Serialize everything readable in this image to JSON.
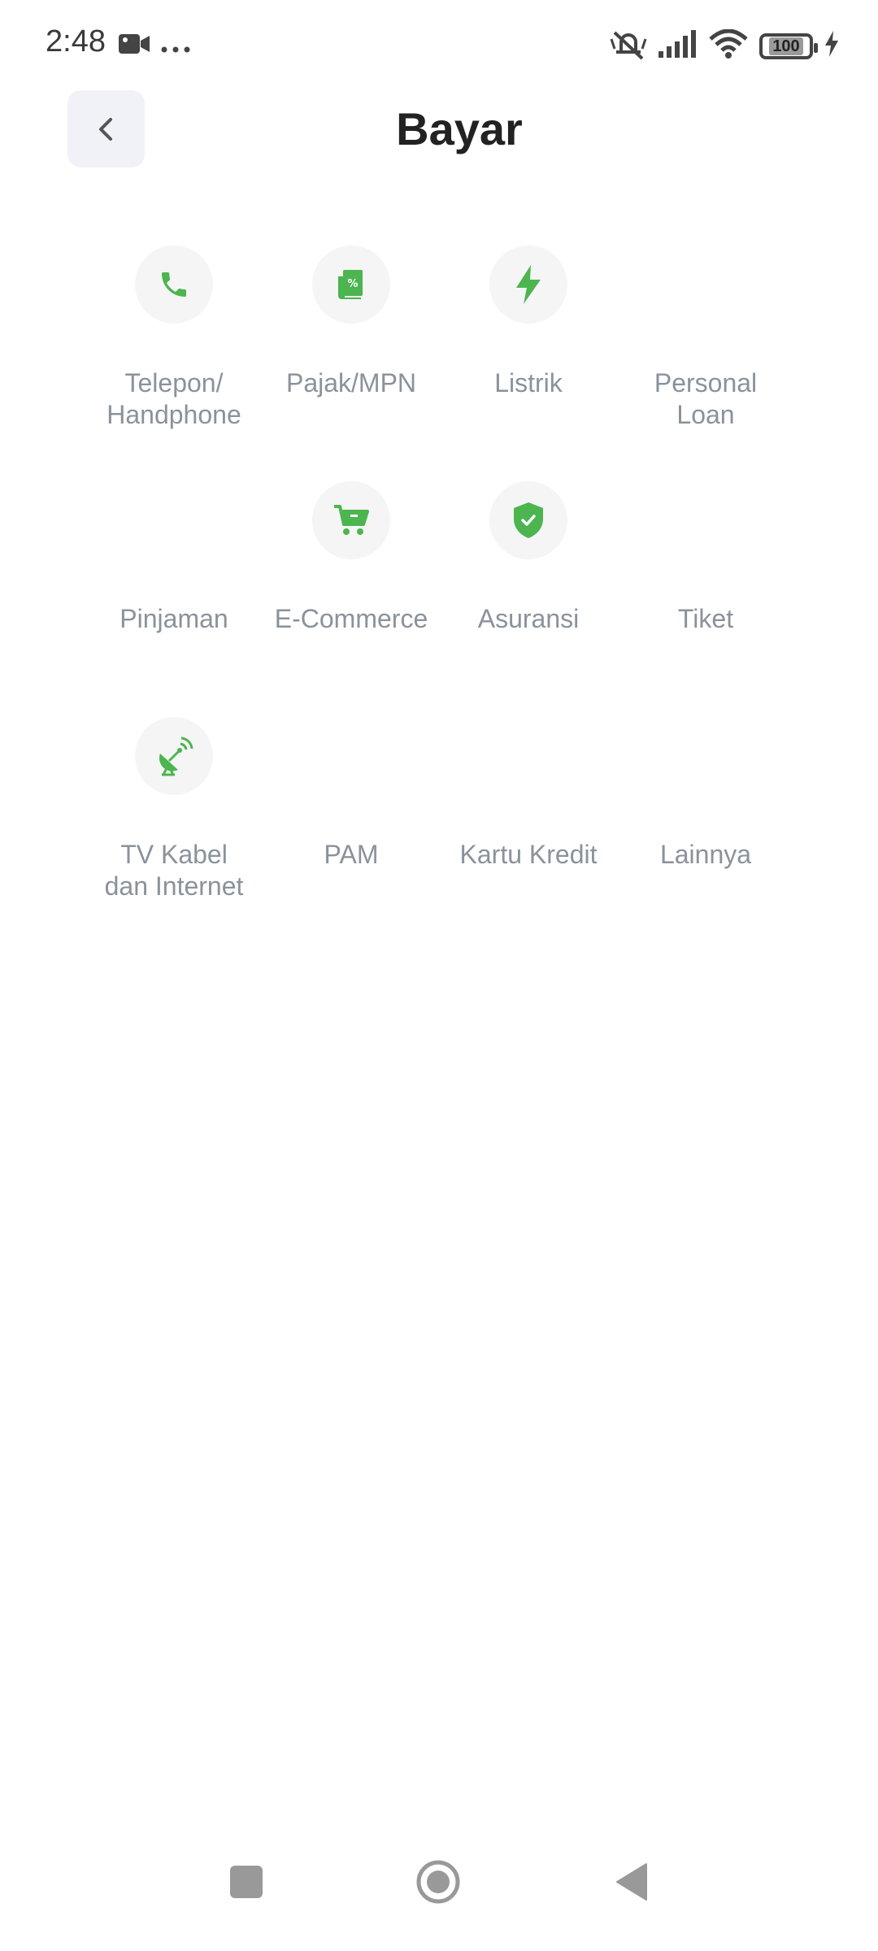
{
  "status": {
    "time": "2:48",
    "battery": "100"
  },
  "header": {
    "title": "Bayar"
  },
  "tiles": [
    {
      "label": "Telepon/\nHandphone",
      "icon": "phone-icon"
    },
    {
      "label": "Pajak/MPN",
      "icon": "tax-receipt-icon"
    },
    {
      "label": "Listrik",
      "icon": "lightning-icon"
    },
    {
      "label": "Personal\nLoan",
      "icon": ""
    },
    {
      "label": "Pinjaman",
      "icon": ""
    },
    {
      "label": "E-Commerce",
      "icon": "shopping-cart-icon"
    },
    {
      "label": "Asuransi",
      "icon": "shield-check-icon"
    },
    {
      "label": "Tiket",
      "icon": ""
    },
    {
      "label": "TV Kabel\ndan Internet",
      "icon": "satellite-dish-icon"
    },
    {
      "label": "PAM",
      "icon": ""
    },
    {
      "label": "Kartu Kredit",
      "icon": ""
    },
    {
      "label": "Lainnya",
      "icon": ""
    }
  ],
  "colors": {
    "accent": "#4cb54f",
    "label": "#8a929b",
    "title": "#222222"
  }
}
